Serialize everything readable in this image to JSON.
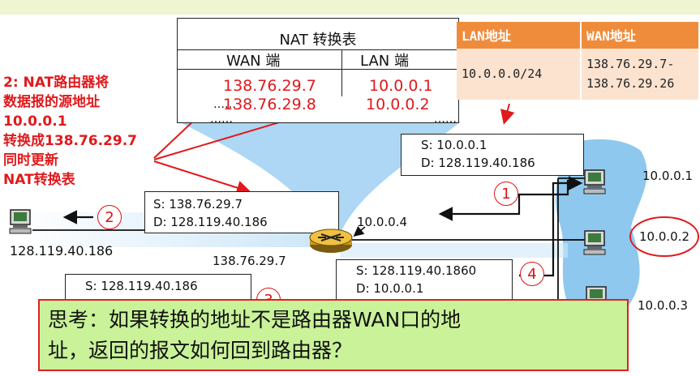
{
  "colors": {
    "accent_red": "#e0191c",
    "lan_blue": "#8ec8ee",
    "table_header": "#ef8c3c",
    "table_body": "#fce3d0",
    "think_bg": "#c9f299"
  },
  "nat_table": {
    "title": "NAT 转换表",
    "col_wan": "WAN 端",
    "col_lan": "LAN 端",
    "rows": [
      {
        "wan": "138.76.29.7",
        "lan": "10.0.0.1"
      },
      {
        "wan": "138.76.29.8",
        "lan": "10.0.0.2"
      }
    ],
    "ellipsis": "……"
  },
  "lan_wan_table": {
    "header_lan": "LAN地址",
    "header_wan": "WAN地址",
    "lan_value": "10.0.0.0/24",
    "wan_value_1": "138.76.29.7-",
    "wan_value_2": "138.76.29.26"
  },
  "annotation": {
    "line1": "2: NAT路由器将",
    "line2": "数据报的源地址",
    "line3": "10.0.0.1",
    "line4": "转换成138.76.29.7",
    "line5": "同时更新",
    "line6": "NAT转换表"
  },
  "packets": {
    "p1": {
      "src": "S: 10.0.0.1",
      "dst": "D: 128.119.40.186"
    },
    "p2": {
      "src": "S: 138.76.29.7",
      "dst": "D: 128.119.40.186"
    },
    "p3": {
      "src": "S: 128.119.40.186"
    },
    "p4": {
      "src": "S: 128.119.40.1860",
      "dst": "D: 10.0.0.1"
    }
  },
  "steps": {
    "s1": "1",
    "s2": "2",
    "s3": "3",
    "s4": "4"
  },
  "addresses": {
    "remote_host": "128.119.40.186",
    "router_wan": "138.76.29.7",
    "router_lan": "10.0.0.4",
    "host1": "10.0.0.1",
    "host2": "10.0.0.2",
    "host3": "10.0.0.3"
  },
  "question": {
    "line1": "思考：如果转换的地址不是路由器WAN口的地",
    "line2": "址，返回的报文如何回到路由器？"
  }
}
